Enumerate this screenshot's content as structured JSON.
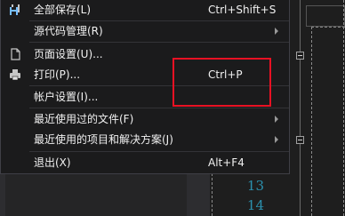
{
  "menu": {
    "items": [
      {
        "label": "全部保存(L)",
        "shortcut": "Ctrl+Shift+S",
        "submenu": false,
        "icon": "save-all-icon"
      },
      {
        "label": "源代码管理(R)",
        "shortcut": "",
        "submenu": true,
        "icon": ""
      },
      {
        "label": "页面设置(U)...",
        "shortcut": "",
        "submenu": false,
        "icon": "page-setup-icon"
      },
      {
        "label": "打印(P)...",
        "shortcut": "Ctrl+P",
        "submenu": false,
        "icon": "print-icon"
      },
      {
        "label": "帐户设置(I)...",
        "shortcut": "",
        "submenu": false,
        "icon": ""
      },
      {
        "label": "最近使用过的文件(F)",
        "shortcut": "",
        "submenu": true,
        "icon": ""
      },
      {
        "label": "最近使用的项目和解决方案(J)",
        "shortcut": "",
        "submenu": true,
        "icon": ""
      },
      {
        "label": "退出(X)",
        "shortcut": "Alt+F4",
        "submenu": false,
        "icon": ""
      }
    ]
  },
  "editor": {
    "line_numbers": [
      "13",
      "14"
    ]
  },
  "colors": {
    "menu_bg": "#1b1b1c",
    "text": "#f1f1f1",
    "line_number": "#2b91af",
    "highlight_box": "#e81123"
  }
}
